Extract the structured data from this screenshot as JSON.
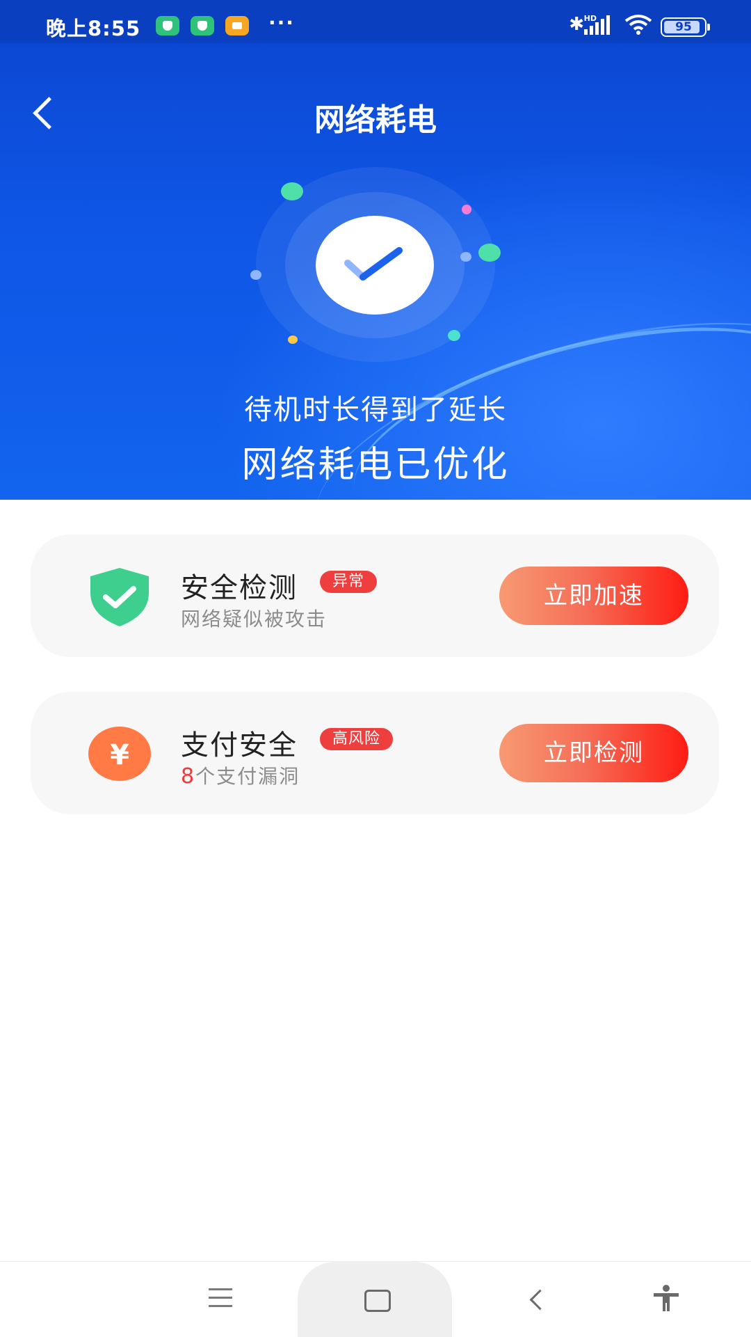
{
  "status_bar": {
    "time": "晚上8:55",
    "more": "···",
    "network_type": "HD",
    "battery": "95"
  },
  "header": {
    "title": "网络耗电",
    "subtitle": "待机时长得到了延长",
    "headline": "网络耗电已优化"
  },
  "cards": [
    {
      "title": "安全检测",
      "badge": "异常",
      "subtitle": "网络疑似被攻击",
      "button": "立即加速",
      "icon": "shield-check-icon",
      "icon_color": "#3ecf8e"
    },
    {
      "title": "支付安全",
      "badge": "高风险",
      "subtitle_number": "8",
      "subtitle": "个支付漏洞",
      "button": "立即检测",
      "icon": "yuan-icon",
      "icon_color": "#ff7a45"
    }
  ],
  "colors": {
    "header_blue": "#0f56e6",
    "badge_red": "#ef3e3e",
    "button_gradient_start": "#f79a72",
    "button_gradient_end": "#ff1c12"
  }
}
